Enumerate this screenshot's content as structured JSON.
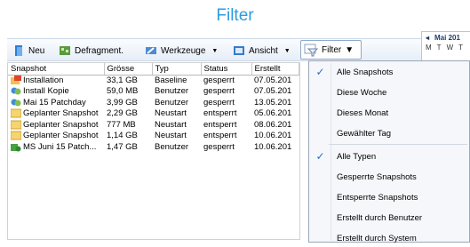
{
  "title": "Filter",
  "toolbar": {
    "new_label": "Neu",
    "defrag_label": "Defragment.",
    "tools_label": "Werkzeuge",
    "view_label": "Ansicht",
    "filter_label": "Filter"
  },
  "calendar": {
    "month": "Mai 201",
    "days": [
      "M",
      "T",
      "W",
      "T"
    ]
  },
  "table": {
    "headers": [
      "Snapshot",
      "Grösse",
      "Typ",
      "Status",
      "Erstellt"
    ],
    "rows": [
      {
        "icon": "installation-icon",
        "name": "Installation",
        "size": "33,1 GB",
        "type": "Baseline",
        "status": "gesperrt",
        "created": "07.05.201"
      },
      {
        "icon": "copy-icon",
        "name": "Install Kopie",
        "size": "59,0 MB",
        "type": "Benutzer",
        "status": "gesperrt",
        "created": "07.05.201"
      },
      {
        "icon": "copy-icon",
        "name": "Mai 15 Patchday",
        "size": "3,99 GB",
        "type": "Benutzer",
        "status": "gesperrt",
        "created": "13.05.201"
      },
      {
        "icon": "folder-icon",
        "name": "Geplanter Snapshot",
        "size": "2,29 GB",
        "type": "Neustart",
        "status": "entsperrt",
        "created": "05.06.201"
      },
      {
        "icon": "folder-icon",
        "name": "Geplanter Snapshot",
        "size": "777 MB",
        "type": "Neustart",
        "status": "entsperrt",
        "created": "08.06.201"
      },
      {
        "icon": "folder-icon",
        "name": "Geplanter Snapshot",
        "size": "1,14 GB",
        "type": "Neustart",
        "status": "entsperrt",
        "created": "10.06.201"
      },
      {
        "icon": "update-icon",
        "name": "MS Juni 15 Patch...",
        "size": "1,47 GB",
        "type": "Benutzer",
        "status": "gesperrt",
        "created": "10.06.201"
      }
    ]
  },
  "menu": {
    "items": [
      {
        "label": "Alle Snapshots",
        "checked": true
      },
      {
        "label": "Diese Woche",
        "checked": false
      },
      {
        "label": "Dieses Monat",
        "checked": false
      },
      {
        "label": "Gewählter Tag",
        "checked": false
      },
      {
        "label": "Alle Typen",
        "checked": true
      },
      {
        "label": "Gesperrte Snapshots",
        "checked": false
      },
      {
        "label": "Entsperrte Snapshots",
        "checked": false
      },
      {
        "label": "Erstellt durch Benutzer",
        "checked": false
      },
      {
        "label": "Erstellt durch System",
        "checked": false
      }
    ],
    "check_glyph": "✓"
  },
  "colors": {
    "accent": "#2e9be0",
    "check": "#2a6fc4"
  }
}
